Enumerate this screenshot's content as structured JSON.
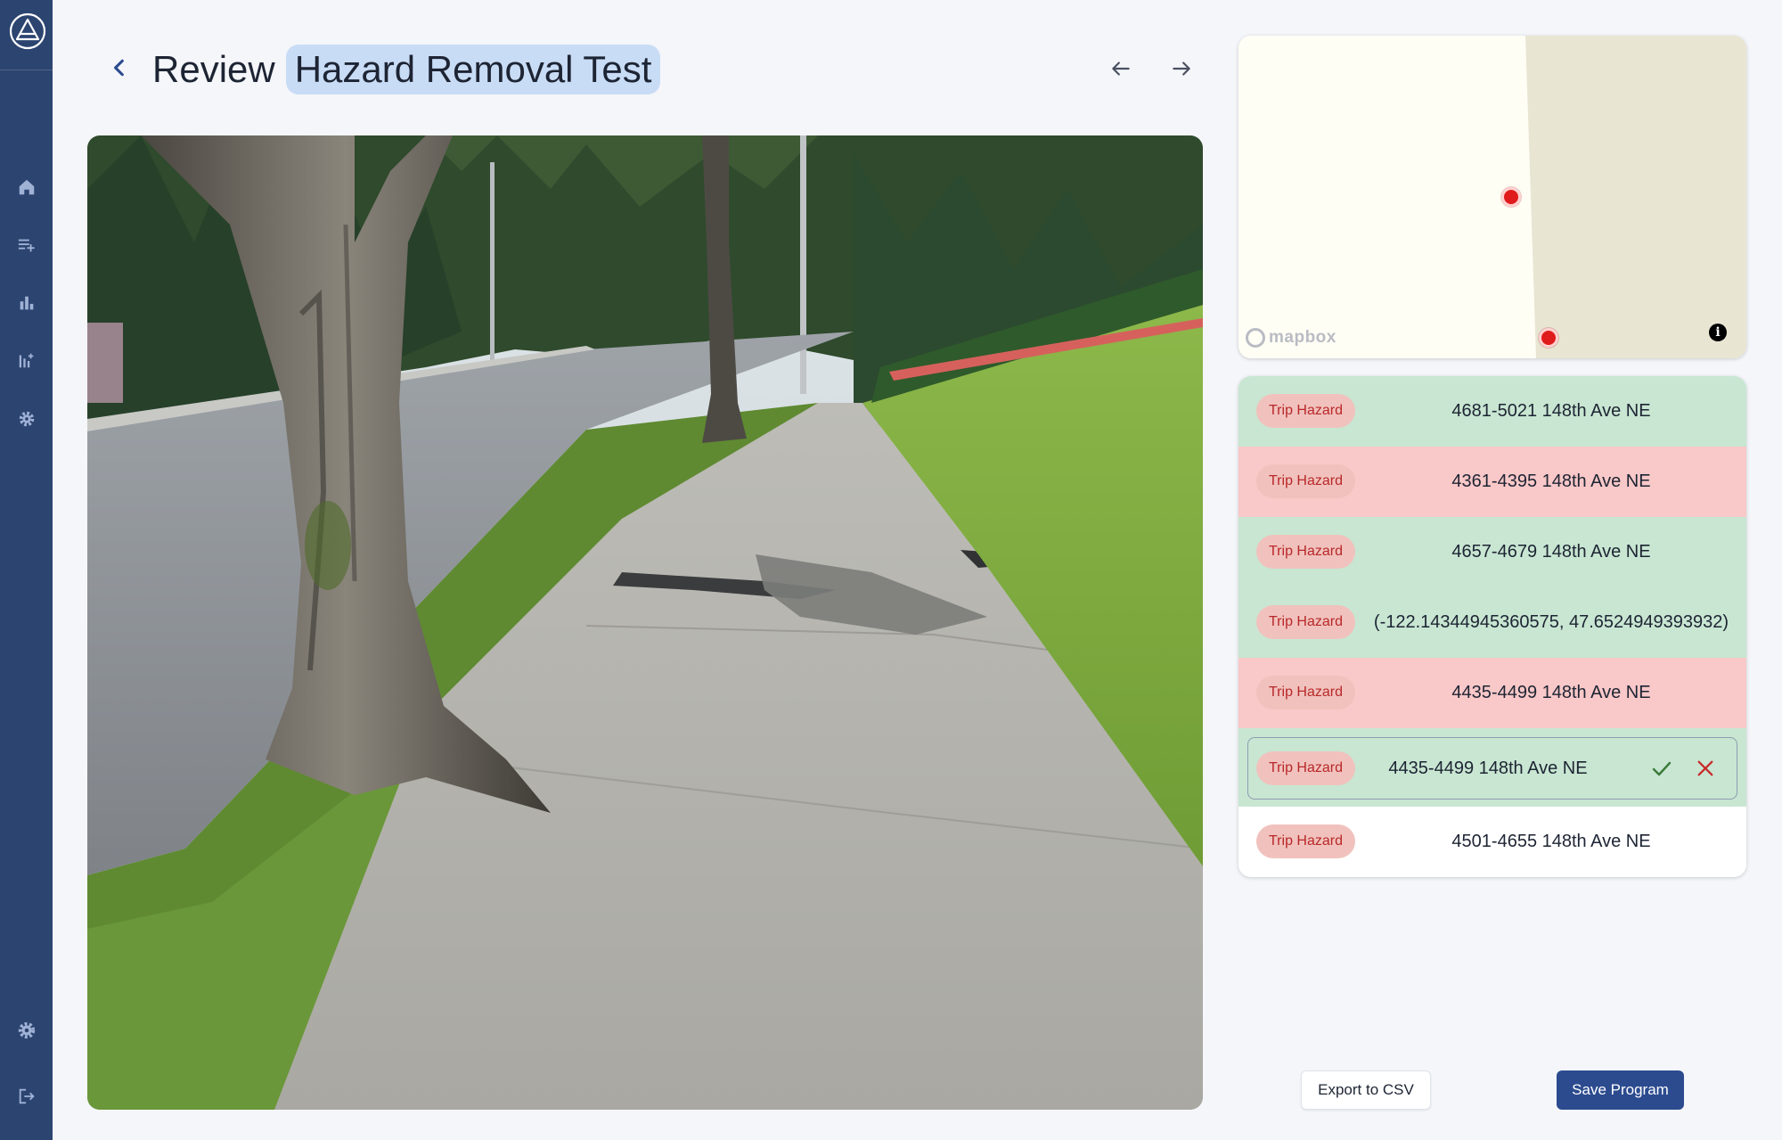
{
  "header": {
    "title_prefix": "Review",
    "program_name": "Hazard Removal Test"
  },
  "sidebar": {
    "items": [
      {
        "icon": "home-icon"
      },
      {
        "icon": "add-list-icon"
      },
      {
        "icon": "bar-chart-icon"
      },
      {
        "icon": "chart-settings-icon"
      },
      {
        "icon": "gear-settings-icon"
      }
    ],
    "bottom": [
      {
        "icon": "settings-icon"
      },
      {
        "icon": "logout-icon"
      }
    ]
  },
  "map": {
    "attribution": "mapbox",
    "info_label": "i",
    "markers": 2
  },
  "hazards": [
    {
      "tag": "Trip Hazard",
      "address": "4681-5021 148th Ave NE",
      "status": "approved"
    },
    {
      "tag": "Trip Hazard",
      "address": "4361-4395 148th Ave NE",
      "status": "rejected"
    },
    {
      "tag": "Trip Hazard",
      "address": "4657-4679 148th Ave NE",
      "status": "approved"
    },
    {
      "tag": "Trip Hazard",
      "address": "(-122.14344945360575, 47.6524949393932)",
      "status": "approved"
    },
    {
      "tag": "Trip Hazard",
      "address": "4435-4499 148th Ave NE",
      "status": "rejected"
    },
    {
      "tag": "Trip Hazard",
      "address": "4435-4499 148th Ave NE",
      "status": "current"
    },
    {
      "tag": "Trip Hazard",
      "address": "4501-4655 148th Ave NE",
      "status": "pending"
    }
  ],
  "actions": {
    "export_label": "Export to CSV",
    "save_label": "Save Program"
  },
  "colors": {
    "sidebar": "#2c4470",
    "approved": "#c8e6d2",
    "rejected": "#f9c8c8",
    "pending": "#ffffff",
    "primary_button": "#2c4b8f",
    "tag_bg": "#f1c2bd",
    "tag_text": "#b8282a"
  }
}
